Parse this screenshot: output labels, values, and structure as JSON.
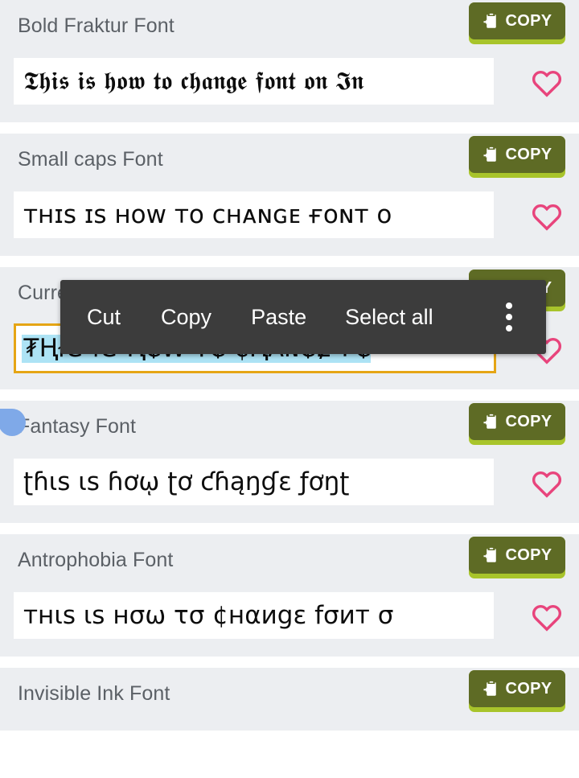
{
  "app": {
    "background": "#eceef1",
    "card_background": "#eceef1",
    "field_background": "#ffffff",
    "accent_green_dark": "#5e6b25",
    "accent_green_light": "#a8c42b",
    "heart_color": "#e8447c",
    "selection_border": "#e5a515",
    "selection_highlight": "#ade3f5",
    "handle_color": "#7fa9e8",
    "menu_background": "#3c3c3c"
  },
  "copy_button": {
    "label": "COPY",
    "icon": "copy-clipboard-icon"
  },
  "favorite": {
    "icon": "heart-outline-icon"
  },
  "context_menu": {
    "visible": true,
    "items": [
      {
        "label": "Cut"
      },
      {
        "label": "Copy"
      },
      {
        "label": "Paste"
      },
      {
        "label": "Select all"
      }
    ],
    "overflow_icon": "more-vertical-icon"
  },
  "selection_handle": {
    "icon": "text-selection-handle-icon"
  },
  "font_cards": [
    {
      "label": "Bold Fraktur Font",
      "sample": "𝕿𝖍𝖎𝖘 𝖎𝖘 𝖍𝖔𝖜 𝖙𝖔 𝖈𝖍𝖆𝖓𝖌𝖊 𝖋𝖔𝖓𝖙 𝖔𝖓 𝕴𝖓",
      "selected": false
    },
    {
      "label": "Small caps Font",
      "sample": "ᴛʜɪs ɪs ʜᴏᴡ ᴛᴏ ᴄʜᴀɴɢᴇ ғᴏɴᴛ ᴏ",
      "selected": false
    },
    {
      "label": "Currency Font",
      "sample": "₮Ⱨł₴ ł₴ Ⱨ₲₩ ₮₲ ₵Ⱨ₳₦₲Ɇ ₣₲",
      "selected": true
    },
    {
      "label": "Fantasy Font",
      "sample": "ʈɦɩs ɩs ɦơῳ ʈơ ƈɦąŋɠɛ ƒơŋʈ",
      "selected": false
    },
    {
      "label": "Antrophobia Font",
      "sample": "ᴛнιs ιs нσω τσ ¢нαиgε fσит σ",
      "selected": false
    },
    {
      "label": "Invisible Ink Font",
      "sample": "",
      "selected": false,
      "text_row_visible": false
    }
  ]
}
